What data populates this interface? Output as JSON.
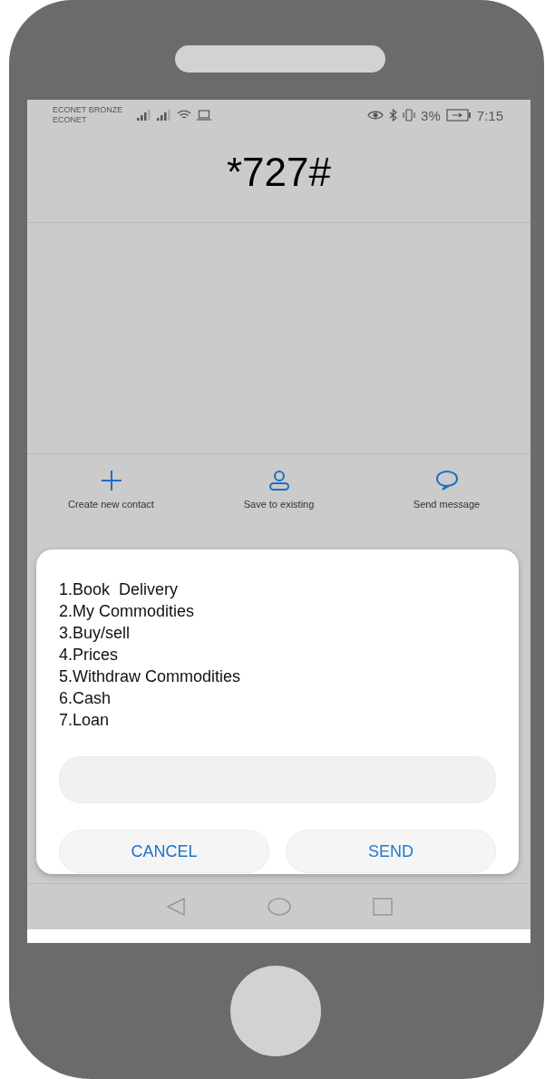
{
  "status_bar": {
    "carriers": [
      "ECONET BRONZE",
      "ECONET"
    ],
    "battery": "3%",
    "time": "7:15"
  },
  "dialed_number": "*727#",
  "actions": [
    {
      "kind": "add",
      "label": "Create new contact"
    },
    {
      "kind": "person",
      "label": "Save to existing"
    },
    {
      "kind": "message",
      "label": "Send message"
    }
  ],
  "ussd_dialog": {
    "menu": [
      "1.Book  Delivery",
      "2.My Commodities",
      "3.Buy/sell",
      "4.Prices",
      "5.Withdraw Commodities",
      "6.Cash",
      "7.Loan"
    ],
    "buttons": [
      {
        "kind": "cancel",
        "label": "CANCEL"
      },
      {
        "kind": "send",
        "label": "SEND"
      }
    ]
  }
}
